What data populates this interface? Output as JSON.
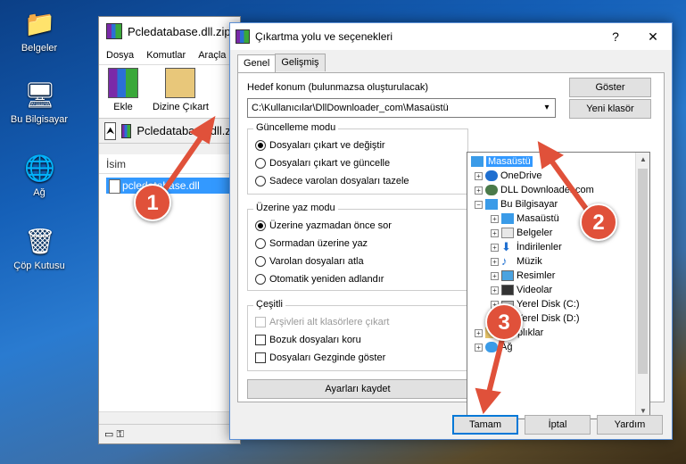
{
  "desktop": {
    "icons": [
      {
        "label": "Belgeler"
      },
      {
        "label": "Bu Bilgisayar"
      },
      {
        "label": "Ağ"
      },
      {
        "label": "Çöp Kutusu"
      }
    ]
  },
  "winrar": {
    "title": "Pcledatabase.dll.zip",
    "menu": [
      "Dosya",
      "Komutlar",
      "Araçla"
    ],
    "toolbar": {
      "add_label": "Ekle",
      "extract_label": "Dizine Çıkart"
    },
    "path_text": "Pcledatabase.dll.zip",
    "column_header": "İsim",
    "file_name": "pcledatabase.dll"
  },
  "dialog": {
    "title": "Çıkartma yolu ve seçenekleri",
    "help_button": "?",
    "close_button": "✕",
    "tabs": [
      "Genel",
      "Gelişmiş"
    ],
    "dest_label": "Hedef konum (bulunmazsa oluşturulacak)",
    "dest_value": "C:\\Kullanıcılar\\DllDownloader_com\\Masaüstü",
    "show_button": "Göster",
    "new_folder_button": "Yeni klasör",
    "update_mode": {
      "title": "Güncelleme modu",
      "options": [
        {
          "label": "Dosyaları çıkart ve değiştir",
          "selected": true
        },
        {
          "label": "Dosyaları çıkart ve güncelle",
          "selected": false
        },
        {
          "label": "Sadece varolan dosyaları tazele",
          "selected": false
        }
      ]
    },
    "overwrite_mode": {
      "title": "Üzerine yaz modu",
      "options": [
        {
          "label": "Üzerine yazmadan önce sor",
          "selected": true
        },
        {
          "label": "Sormadan üzerine yaz",
          "selected": false
        },
        {
          "label": "Varolan dosyaları atla",
          "selected": false
        },
        {
          "label": "Otomatik yeniden adlandır",
          "selected": false
        }
      ]
    },
    "misc": {
      "title": "Çeşitli",
      "options": [
        {
          "label": "Arşivleri alt klasörlere çıkart",
          "checked": false,
          "disabled": true
        },
        {
          "label": "Bozuk dosyaları koru",
          "checked": false,
          "disabled": false
        },
        {
          "label": "Dosyaları Gezginde göster",
          "checked": false,
          "disabled": false
        }
      ]
    },
    "save_settings_button": "Ayarları kaydet",
    "tree": [
      {
        "label": "Masaüstü",
        "selected": true
      },
      {
        "label": "OneDrive"
      },
      {
        "label": "DLL Downloader.com"
      },
      {
        "label": "Bu Bilgisayar"
      },
      {
        "label": "Masaüstü"
      },
      {
        "label": "Belgeler"
      },
      {
        "label": "İndirilenler"
      },
      {
        "label": "Müzik"
      },
      {
        "label": "Resimler"
      },
      {
        "label": "Videolar"
      },
      {
        "label": "Yerel Disk (C:)"
      },
      {
        "label": "Yerel Disk (D:)"
      },
      {
        "label": "Kitaplıklar"
      },
      {
        "label": "Ağ"
      }
    ],
    "ok_button": "Tamam",
    "cancel_button": "İptal",
    "help_footer_button": "Yardım"
  },
  "annotations": [
    "1",
    "2",
    "3"
  ],
  "colors": {
    "annotation": "#e0513a",
    "selection": "#3399ff",
    "accent": "#0078d7"
  }
}
